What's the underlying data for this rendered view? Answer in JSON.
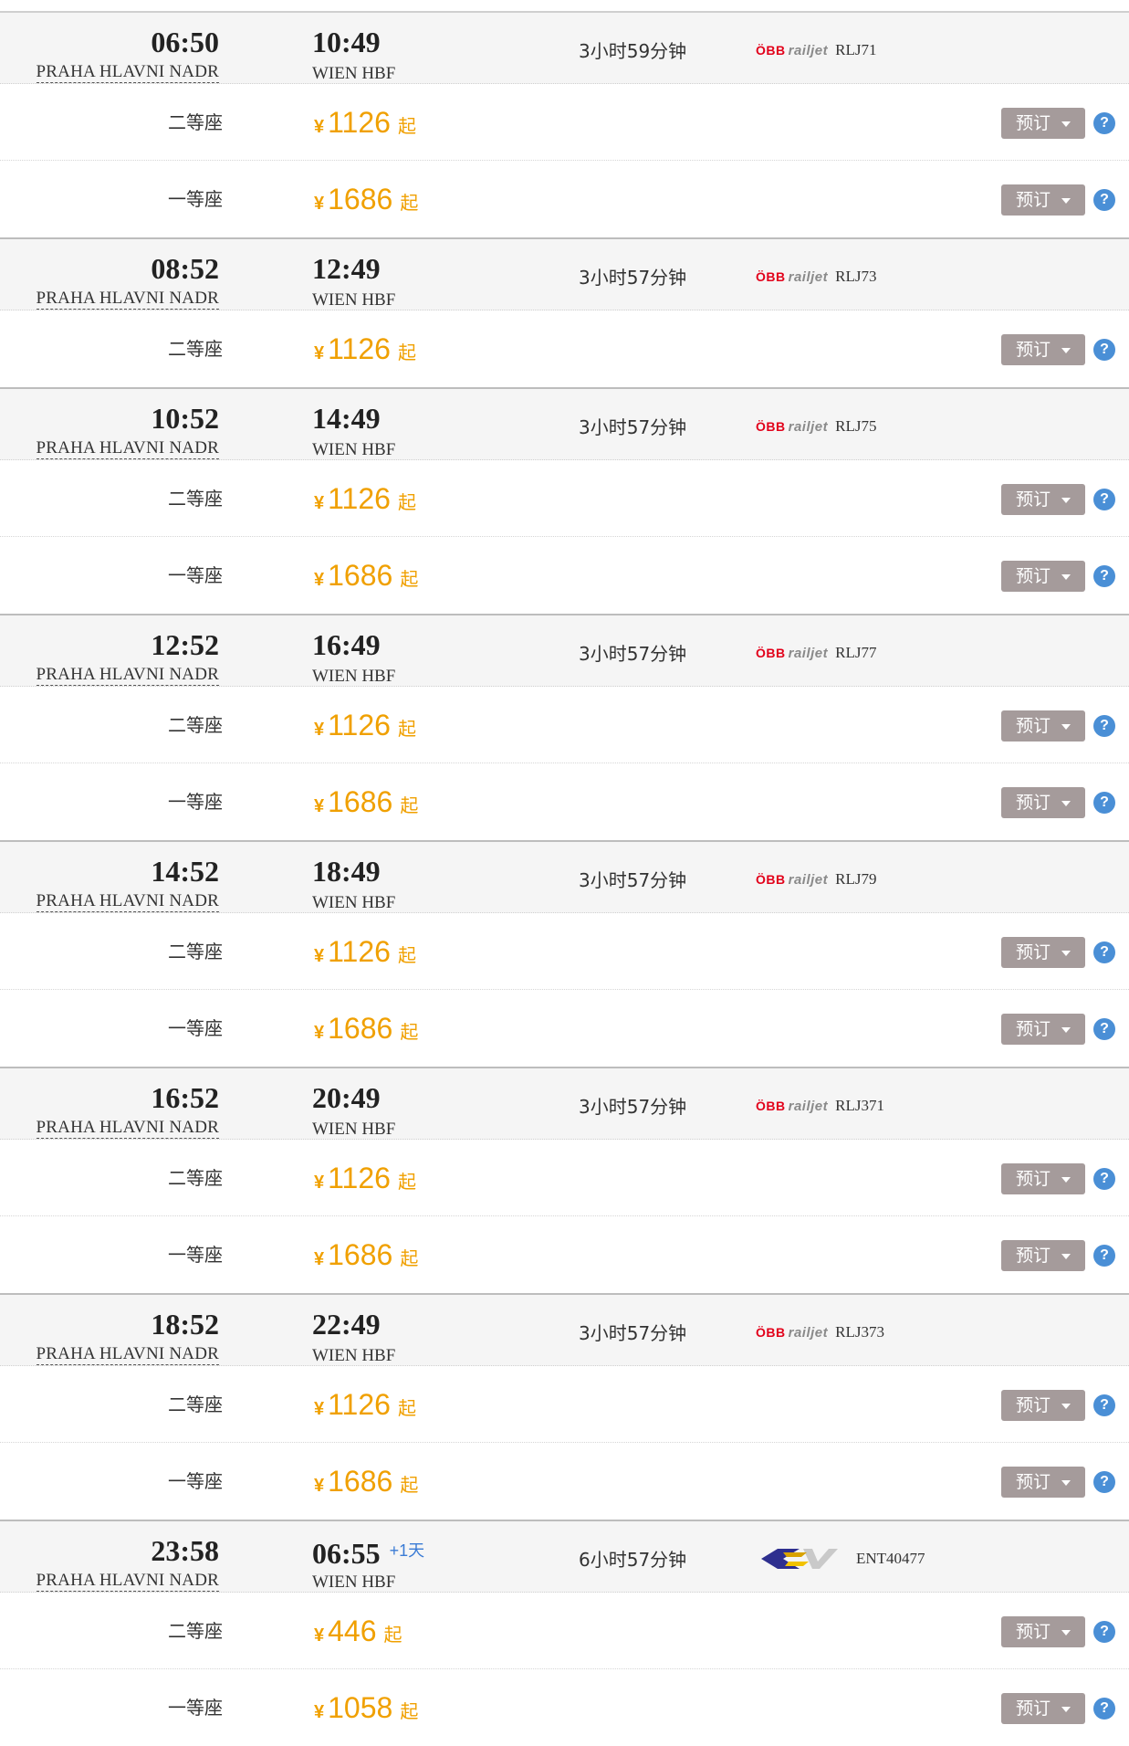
{
  "book_label": "预订",
  "help_symbol": "?",
  "start_price_suffix": "起",
  "currency_symbol": "¥",
  "colors": {
    "price": "#f0a000",
    "book_button": "#a59b9b",
    "help_icon": "#4a8fd6",
    "header_bg": "#f5f5f5",
    "obb_red": "#e2001a",
    "plus_day": "#3a7bd5"
  },
  "trains": [
    {
      "departure_time": "06:50",
      "departure_station": "PRAHA HLAVNI NADR",
      "arrival_time": "10:49",
      "arrival_station": "WIEN HBF",
      "duration": "3小时59分钟",
      "operator_logo": "obb-railjet",
      "operator_text": [
        "ÖBB",
        "railjet"
      ],
      "train_number": "RLJ71",
      "seats": [
        {
          "class": "二等座",
          "price": "1126"
        },
        {
          "class": "一等座",
          "price": "1686"
        }
      ]
    },
    {
      "departure_time": "08:52",
      "departure_station": "PRAHA HLAVNI NADR",
      "arrival_time": "12:49",
      "arrival_station": "WIEN HBF",
      "duration": "3小时57分钟",
      "operator_logo": "obb-railjet",
      "operator_text": [
        "ÖBB",
        "railjet"
      ],
      "train_number": "RLJ73",
      "seats": [
        {
          "class": "二等座",
          "price": "1126"
        }
      ]
    },
    {
      "departure_time": "10:52",
      "departure_station": "PRAHA HLAVNI NADR",
      "arrival_time": "14:49",
      "arrival_station": "WIEN HBF",
      "duration": "3小时57分钟",
      "operator_logo": "obb-railjet",
      "operator_text": [
        "ÖBB",
        "railjet"
      ],
      "train_number": "RLJ75",
      "seats": [
        {
          "class": "二等座",
          "price": "1126"
        },
        {
          "class": "一等座",
          "price": "1686"
        }
      ]
    },
    {
      "departure_time": "12:52",
      "departure_station": "PRAHA HLAVNI NADR",
      "arrival_time": "16:49",
      "arrival_station": "WIEN HBF",
      "duration": "3小时57分钟",
      "operator_logo": "obb-railjet",
      "operator_text": [
        "ÖBB",
        "railjet"
      ],
      "train_number": "RLJ77",
      "seats": [
        {
          "class": "二等座",
          "price": "1126"
        },
        {
          "class": "一等座",
          "price": "1686"
        }
      ]
    },
    {
      "departure_time": "14:52",
      "departure_station": "PRAHA HLAVNI NADR",
      "arrival_time": "18:49",
      "arrival_station": "WIEN HBF",
      "duration": "3小时57分钟",
      "operator_logo": "obb-railjet",
      "operator_text": [
        "ÖBB",
        "railjet"
      ],
      "train_number": "RLJ79",
      "seats": [
        {
          "class": "二等座",
          "price": "1126"
        },
        {
          "class": "一等座",
          "price": "1686"
        }
      ]
    },
    {
      "departure_time": "16:52",
      "departure_station": "PRAHA HLAVNI NADR",
      "arrival_time": "20:49",
      "arrival_station": "WIEN HBF",
      "duration": "3小时57分钟",
      "operator_logo": "obb-railjet",
      "operator_text": [
        "ÖBB",
        "railjet"
      ],
      "train_number": "RLJ371",
      "seats": [
        {
          "class": "二等座",
          "price": "1126"
        },
        {
          "class": "一等座",
          "price": "1686"
        }
      ]
    },
    {
      "departure_time": "18:52",
      "departure_station": "PRAHA HLAVNI NADR",
      "arrival_time": "22:49",
      "arrival_station": "WIEN HBF",
      "duration": "3小时57分钟",
      "operator_logo": "obb-railjet",
      "operator_text": [
        "ÖBB",
        "railjet"
      ],
      "train_number": "RLJ373",
      "seats": [
        {
          "class": "二等座",
          "price": "1126"
        },
        {
          "class": "一等座",
          "price": "1686"
        }
      ]
    },
    {
      "departure_time": "23:58",
      "departure_station": "PRAHA HLAVNI NADR",
      "arrival_time": "06:55",
      "arrival_day_offset": "+1天",
      "arrival_station": "WIEN HBF",
      "duration": "6小时57分钟",
      "operator_logo": "ent",
      "train_number": "ENT40477",
      "seats": [
        {
          "class": "二等座",
          "price": "446"
        },
        {
          "class": "一等座",
          "price": "1058"
        }
      ]
    }
  ]
}
